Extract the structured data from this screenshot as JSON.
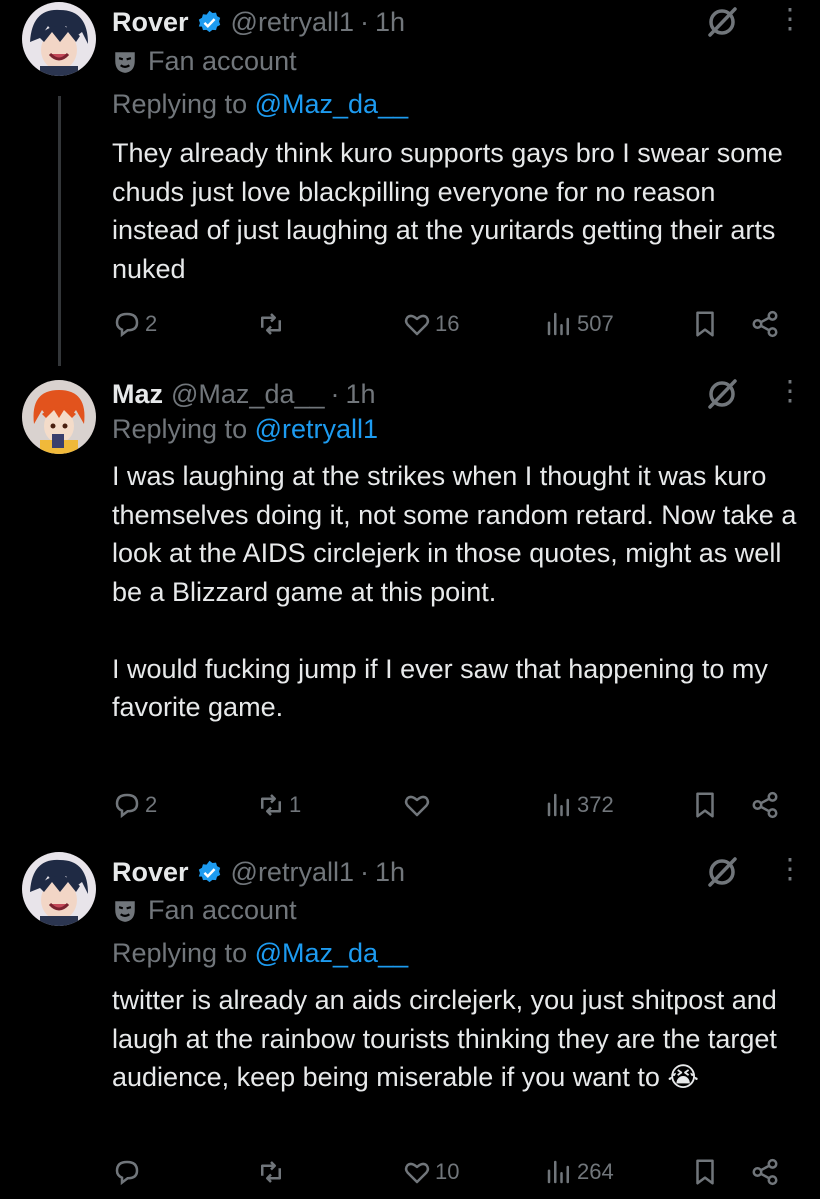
{
  "posts": [
    {
      "name": "Rover",
      "verified": true,
      "handle": "@retryall1",
      "dot": "·",
      "time": "1h",
      "label": "Fan account",
      "replying_prefix": "Replying to",
      "replying_to": "@Maz_da__",
      "text": "They already think kuro supports gays bro I swear some chuds just love blackpilling everyone for no reason instead of just laughing at the yuritards getting their arts nuked",
      "replies": "2",
      "reposts": "",
      "likes": "16",
      "views": "507"
    },
    {
      "name": "Maz",
      "verified": false,
      "handle": "@Maz_da__",
      "dot": "·",
      "time": "1h",
      "replying_prefix": "Replying to",
      "replying_to": "@retryall1",
      "text": "I was laughing at the strikes when I thought it was kuro themselves doing it, not some random retard. Now take a look at the AIDS circlejerk in those quotes, might as well be a Blizzard game at this point.\n\nI would fucking jump if I ever saw that happening to my favorite game.",
      "replies": "2",
      "reposts": "1",
      "likes": "",
      "views": "372"
    },
    {
      "name": "Rover",
      "verified": true,
      "handle": "@retryall1",
      "dot": "·",
      "time": "1h",
      "label": "Fan account",
      "replying_prefix": "Replying to",
      "replying_to": "@Maz_da__",
      "text": "twitter is already an aids circlejerk, you just shitpost and laugh at the rainbow tourists thinking they are the target audience, keep being miserable if you want to 😭",
      "replies": "",
      "reposts": "",
      "likes": "10",
      "views": "264"
    }
  ],
  "icons": {
    "reply": "reply-icon",
    "repost": "repost-icon",
    "like": "heart-icon",
    "views": "views-icon",
    "bookmark": "bookmark-icon",
    "share": "share-icon",
    "grok": "grok-icon",
    "more": "more-icon",
    "verified": "verified-badge-icon",
    "fan": "mask-icon"
  },
  "colors": {
    "background": "#000000",
    "text": "#e7e9ea",
    "muted": "#71767b",
    "link": "#1d9bf0"
  },
  "more_glyph": "⋮"
}
